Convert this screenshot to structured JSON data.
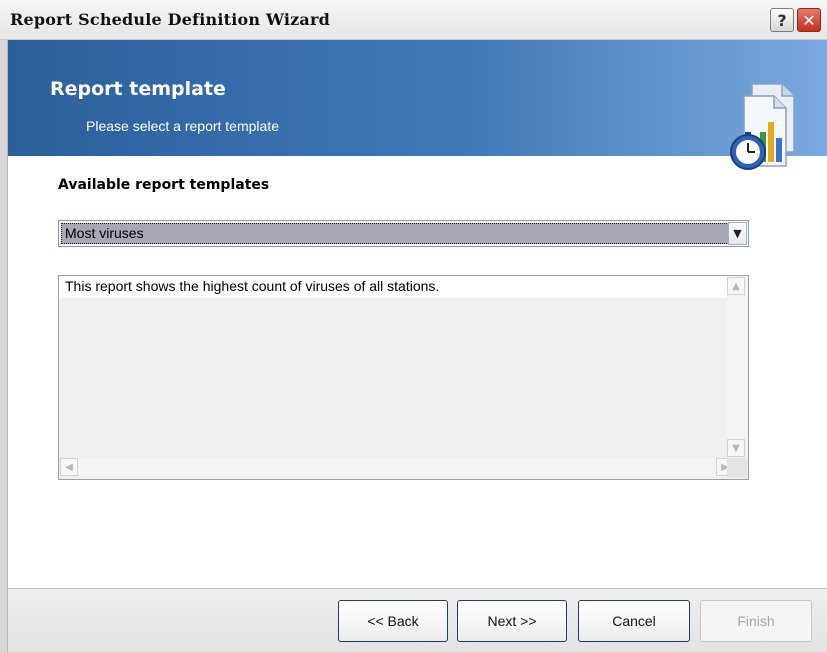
{
  "window": {
    "title": "Report Schedule Definition Wizard",
    "help_label": "?",
    "close_label": "✕"
  },
  "banner": {
    "title": "Report template",
    "subtitle": "Please select a report template",
    "icon": "report-clock-chart-icon"
  },
  "templates": {
    "label": "Available report templates",
    "selected": "Most viruses",
    "dropdown_icon": "chevron-down-icon"
  },
  "description": {
    "text": "This report shows the highest count of viruses of all stations."
  },
  "buttons": {
    "back": "<< Back",
    "next": "Next >>",
    "cancel": "Cancel",
    "finish": "Finish",
    "finish_enabled": false
  },
  "colors": {
    "banner_start": "#2b5f9c",
    "banner_end": "#7aaae0",
    "close_button": "#c2301f",
    "button_border": "#1c3a73"
  }
}
